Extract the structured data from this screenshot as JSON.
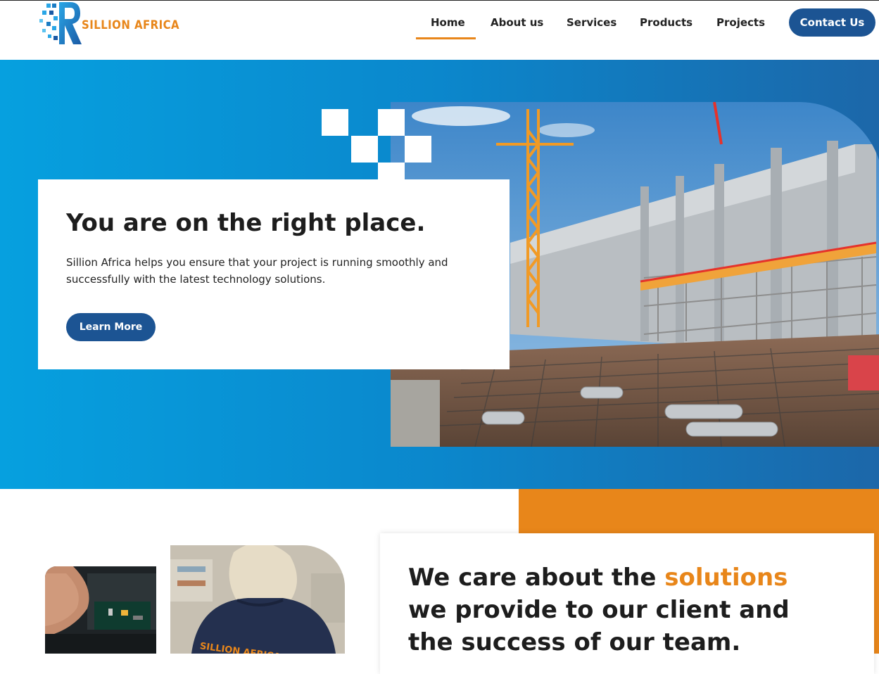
{
  "brand": {
    "name": "SILLION AFRICA",
    "accent": "#e8861a",
    "primary": "#1c5493"
  },
  "nav": {
    "items": [
      {
        "label": "Home",
        "active": true
      },
      {
        "label": "About us",
        "active": false
      },
      {
        "label": "Services",
        "active": false
      },
      {
        "label": "Products",
        "active": false
      },
      {
        "label": "Projects",
        "active": false
      }
    ],
    "contact_label": "Contact Us"
  },
  "hero": {
    "title": "You are on the right place.",
    "text": "Sillion Africa helps you ensure that your project is running smoothly and successfully with the latest technology solutions.",
    "button_label": "Learn More",
    "image": "construction-site-photo"
  },
  "care": {
    "title_before": "We care about the ",
    "title_accent": "solutions",
    "title_after": " we provide to our client and the success of our team.",
    "images": [
      "electronics-repair-photo",
      "worker-in-jacket-photo"
    ],
    "jacket_text": "SILLION AFRICA LTD"
  }
}
